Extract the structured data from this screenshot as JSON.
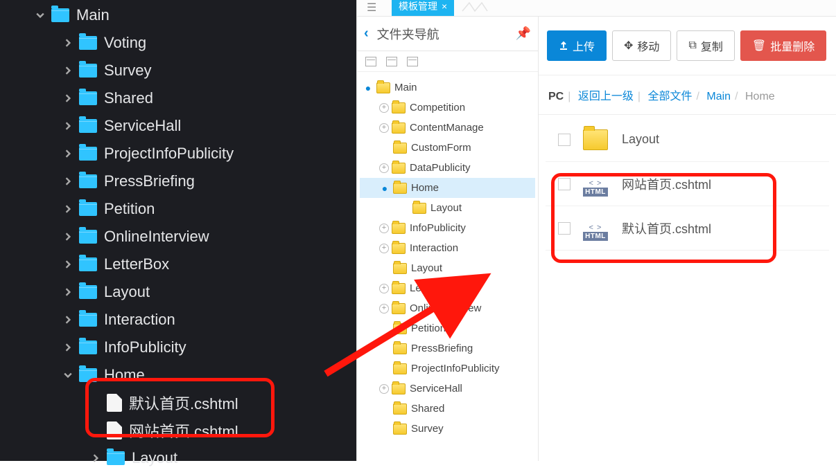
{
  "left_tree": {
    "root": "Main",
    "children": [
      "Voting",
      "Survey",
      "Shared",
      "ServiceHall",
      "ProjectInfoPublicity",
      "PressBriefing",
      "Petition",
      "OnlineInterview",
      "LetterBox",
      "Layout",
      "Interaction",
      "InfoPublicity"
    ],
    "home": "Home",
    "home_files": [
      "默认首页.cshtml",
      "网站首页.cshtml"
    ],
    "home_sub": "Layout"
  },
  "tab": {
    "label": "模板管理",
    "close": "×"
  },
  "nav": {
    "title": "文件夹导航"
  },
  "mid_tree": {
    "root": "Main",
    "items": [
      {
        "t": "Competition",
        "exp": true
      },
      {
        "t": "ContentManage",
        "exp": true
      },
      {
        "t": "CustomForm",
        "exp": false
      },
      {
        "t": "DataPublicity",
        "exp": true
      },
      {
        "t": "Home",
        "exp": true,
        "sel": true,
        "minus": true
      },
      {
        "t": "InfoPublicity",
        "exp": true
      },
      {
        "t": "Interaction",
        "exp": true
      },
      {
        "t": "Layout",
        "exp": false
      },
      {
        "t": "LetterBox",
        "exp": true
      },
      {
        "t": "OnlineInterview",
        "exp": true
      },
      {
        "t": "Petition",
        "exp": false
      },
      {
        "t": "PressBriefing",
        "exp": false
      },
      {
        "t": "ProjectInfoPublicity",
        "exp": false
      },
      {
        "t": "ServiceHall",
        "exp": true
      },
      {
        "t": "Shared",
        "exp": false
      },
      {
        "t": "Survey",
        "exp": false
      }
    ],
    "home_child": "Layout"
  },
  "buttons": {
    "upload": "上传",
    "move": "移动",
    "copy": "复制",
    "del": "批量删除"
  },
  "crumb": {
    "pc": "PC",
    "back": "返回上一级",
    "all": "全部文件",
    "main": "Main",
    "home": "Home"
  },
  "files": {
    "folder": "Layout",
    "f1": "网站首页.cshtml",
    "f2": "默认首页.cshtml",
    "html_top": "< >",
    "html_bot": "HTML"
  }
}
